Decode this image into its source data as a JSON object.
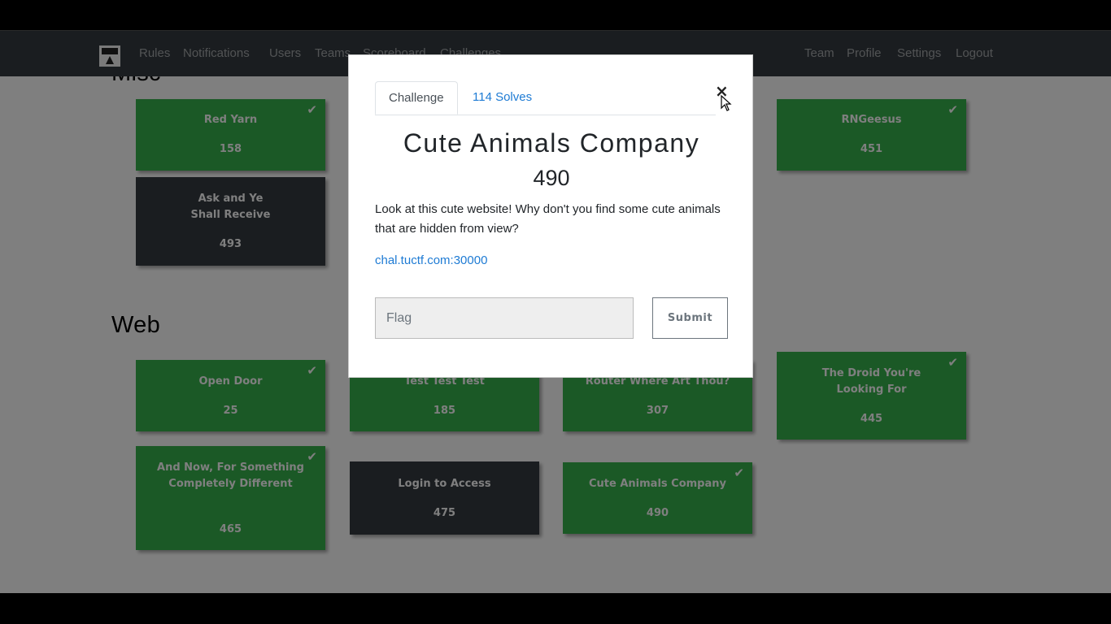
{
  "navbar": {
    "left_links": [
      "Rules",
      "Notifications",
      "Users",
      "Teams",
      "Scoreboard",
      "Challenges"
    ],
    "right_links": [
      "Team",
      "Profile",
      "Settings",
      "Logout"
    ]
  },
  "sections": {
    "misc": {
      "title": "Misc",
      "cards": [
        {
          "name": "Red Yarn",
          "value": "158",
          "solved": true
        },
        {
          "name": "RNGeesus",
          "value": "451",
          "solved": true
        },
        {
          "name": "Ask and Ye Shall Receive",
          "value": "493",
          "solved": false
        }
      ]
    },
    "web": {
      "title": "Web",
      "cards": [
        {
          "name": "Open Door",
          "value": "25",
          "solved": true
        },
        {
          "name": "Test Test Test",
          "value": "185",
          "solved": true
        },
        {
          "name": "Router Where Art Thou?",
          "value": "307",
          "solved": true
        },
        {
          "name": "The Droid You're Looking For",
          "value": "445",
          "solved": true
        },
        {
          "name": "And Now, For Something Completely Different",
          "value": "465",
          "solved": true
        },
        {
          "name": "Login to Access",
          "value": "475",
          "solved": false
        },
        {
          "name": "Cute Animals Company",
          "value": "490",
          "solved": true
        }
      ]
    }
  },
  "modal": {
    "tab_challenge": "Challenge",
    "tab_solves": "114 Solves",
    "close_symbol": "×",
    "title": "Cute Animals Company",
    "value": "490",
    "description": "Look at this cute website! Why don't you find some cute animals that are hidden from view?",
    "link": "chal.tuctf.com:30000",
    "flag_placeholder": "Flag",
    "flag_value": "",
    "submit_label": "Submit"
  },
  "colors": {
    "solved": "#37b24d",
    "unsolved": "#343a40",
    "navbar": "#343a40",
    "link": "#1e7bd4"
  }
}
